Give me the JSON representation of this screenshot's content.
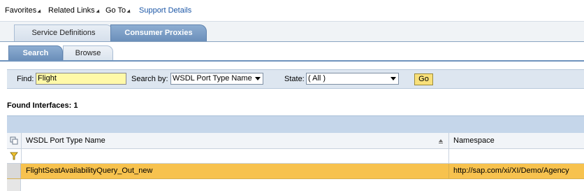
{
  "menu": {
    "favorites": "Favorites",
    "related_links": "Related Links",
    "go_to": "Go To",
    "support_details": "Support Details"
  },
  "top_tabs": [
    {
      "label": "Service Definitions",
      "active": false
    },
    {
      "label": "Consumer Proxies",
      "active": true
    }
  ],
  "sub_tabs": [
    {
      "label": "Search",
      "active": true
    },
    {
      "label": "Browse",
      "active": false
    }
  ],
  "search": {
    "find_label": "Find:",
    "find_value": "Flight",
    "search_by_label": "Search by:",
    "search_by_value": "WSDL Port Type Name",
    "state_label": "State:",
    "state_value": "( All )",
    "go_label": "Go"
  },
  "results": {
    "found_text": "Found Interfaces: 1",
    "columns": [
      "WSDL Port Type Name",
      "Namespace"
    ],
    "rows": [
      {
        "name": "FlightSeatAvailabilityQuery_Out_new",
        "namespace": "http://sap.com/xi/XI/Demo/Agency",
        "selected": true
      }
    ]
  },
  "colors": {
    "selected_row": "#f7c24e",
    "find_input": "#fff9a8",
    "active_tab": "#6b8fba",
    "link": "#1b56a6"
  },
  "icons": {
    "select_all": "select-all-icon",
    "filter": "filter-icon",
    "sort": "sort-icon"
  }
}
